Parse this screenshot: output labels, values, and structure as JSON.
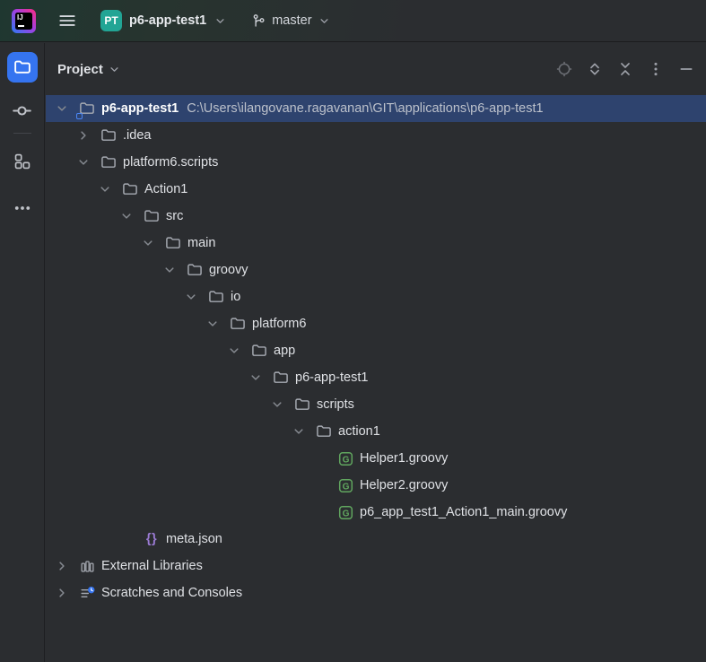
{
  "header": {
    "app_icon": "intellij-idea-logo",
    "app_logo_text": "IJ",
    "menu_icon": "hamburger-menu-icon",
    "project_badge": "PT",
    "project_name": "p6-app-test1",
    "branch_icon": "git-branch-icon",
    "branch_name": "master"
  },
  "sidebar": {
    "items": [
      {
        "name": "project",
        "icon": "folder-icon",
        "active": true
      },
      {
        "name": "commit",
        "icon": "commit-icon",
        "active": false
      },
      {
        "name": "divider"
      },
      {
        "name": "structure",
        "icon": "three-squares-icon",
        "active": false
      },
      {
        "name": "more-tool-windows",
        "icon": "ellipsis-icon",
        "active": false
      }
    ]
  },
  "panel": {
    "title": "Project",
    "title_chevron": "chevron-down-icon",
    "toolbar_icons": [
      {
        "name": "locate-file-icon",
        "disabled": true
      },
      {
        "name": "expand-all-icon",
        "disabled": false
      },
      {
        "name": "collapse-all-icon",
        "disabled": false
      },
      {
        "name": "kebab-menu-icon",
        "disabled": false
      },
      {
        "name": "hide-icon",
        "disabled": false
      }
    ]
  },
  "tree": {
    "rows": [
      {
        "level": 0,
        "chevron": "down",
        "icon": "folder-root",
        "label": "p6-app-test1",
        "path": "C:\\Users\\ilangovane.ragavanan\\GIT\\applications\\p6-app-test1",
        "selected": true,
        "bold": true
      },
      {
        "level": 1,
        "chevron": "right",
        "icon": "folder",
        "label": ".idea"
      },
      {
        "level": 1,
        "chevron": "down",
        "icon": "folder",
        "label": "platform6.scripts"
      },
      {
        "level": 2,
        "chevron": "down",
        "icon": "folder",
        "label": "Action1"
      },
      {
        "level": 3,
        "chevron": "down",
        "icon": "folder",
        "label": "src"
      },
      {
        "level": 4,
        "chevron": "down",
        "icon": "folder",
        "label": "main"
      },
      {
        "level": 5,
        "chevron": "down",
        "icon": "folder",
        "label": "groovy"
      },
      {
        "level": 6,
        "chevron": "down",
        "icon": "folder",
        "label": "io"
      },
      {
        "level": 7,
        "chevron": "down",
        "icon": "folder",
        "label": "platform6"
      },
      {
        "level": 8,
        "chevron": "down",
        "icon": "folder",
        "label": "app"
      },
      {
        "level": 9,
        "chevron": "down",
        "icon": "folder",
        "label": "p6-app-test1"
      },
      {
        "level": 10,
        "chevron": "down",
        "icon": "folder",
        "label": "scripts"
      },
      {
        "level": 11,
        "chevron": "down",
        "icon": "folder",
        "label": "action1"
      },
      {
        "level": 12,
        "chevron": "none",
        "icon": "groovy",
        "label": "Helper1.groovy"
      },
      {
        "level": 12,
        "chevron": "none",
        "icon": "groovy",
        "label": "Helper2.groovy"
      },
      {
        "level": 12,
        "chevron": "none",
        "icon": "groovy",
        "label": "p6_app_test1_Action1_main.groovy"
      },
      {
        "level": 3,
        "chevron": "none",
        "icon": "json",
        "label": "meta.json"
      },
      {
        "level": 0,
        "chevron": "right",
        "icon": "library",
        "label": "External Libraries"
      },
      {
        "level": 0,
        "chevron": "right",
        "icon": "scratches",
        "label": "Scratches and Consoles"
      }
    ]
  },
  "colors": {
    "background": "#2b2d30",
    "border": "#1e1f22",
    "selection": "#2e436e",
    "accent": "#3574f0",
    "badge_teal": "#22a595",
    "groovy_green": "#61a75f",
    "json_purple": "#9b7bd4",
    "text": "#dfe1e5",
    "text_secondary": "#bcc1cb"
  }
}
